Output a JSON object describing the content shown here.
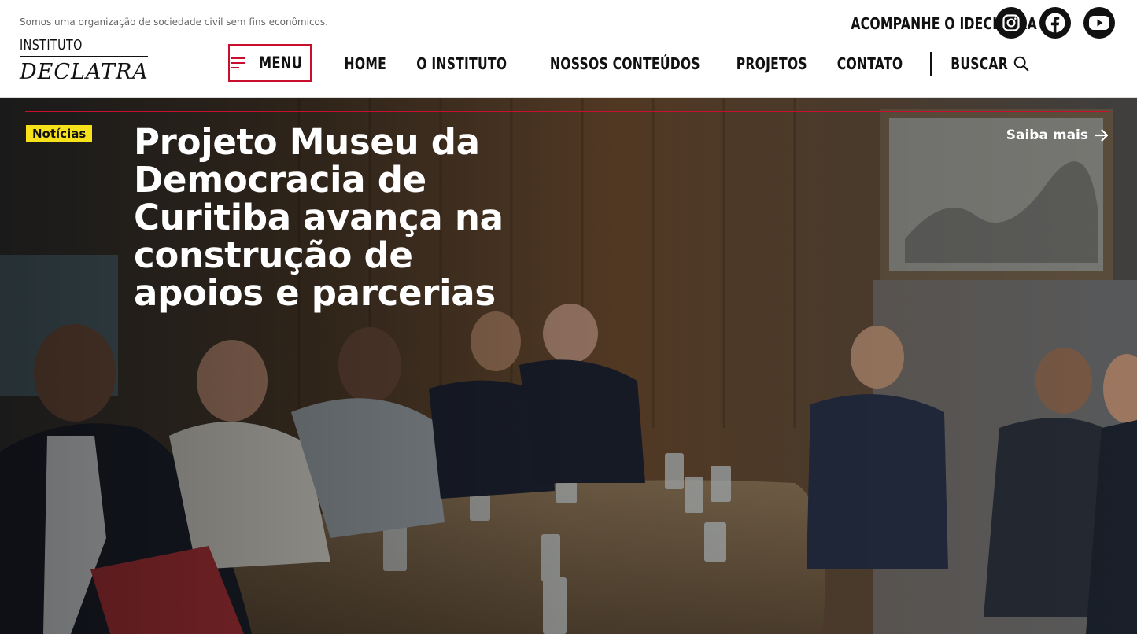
{
  "header": {
    "tagline": "Somos uma organização de sociedade civil sem fins econômicos.",
    "logo": {
      "line1": "INSTITUTO",
      "line2": "DECLATRA"
    },
    "menu_label": "MENU",
    "nav": [
      "HOME",
      "O INSTITUTO",
      "NOSSOS CONTEÚDOS",
      "PROJETOS",
      "CONTATO"
    ],
    "search_label": "BUSCAR",
    "follow_label": "ACOMPANHE O IDECLATRA",
    "social": [
      "instagram-icon",
      "facebook-icon",
      "youtube-icon"
    ]
  },
  "hero": {
    "badge": "Notícias",
    "headline": "Projeto Museu da Democracia de Curitiba avança na construção de apoios e parcerias",
    "cta": "Saiba mais"
  },
  "colors": {
    "accent_red": "#c8102e",
    "badge_yellow": "#f7e11a",
    "text_dark": "#111111"
  }
}
